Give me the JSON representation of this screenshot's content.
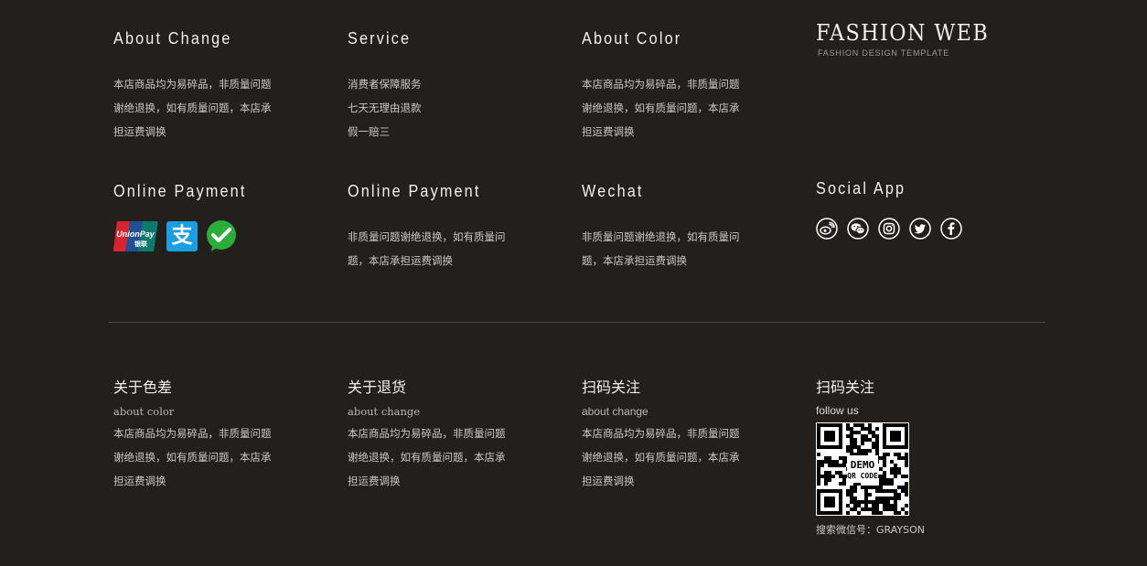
{
  "top_row": [
    {
      "heading": "About Change",
      "lines": [
        "本店商品均为易碎品，非质量问题",
        "谢绝退换，如有质量问题，本店承",
        "担运费调换"
      ]
    },
    {
      "heading": "Service",
      "lines": [
        "消费者保障服务",
        "七天无理由退款",
        "假一赔三"
      ]
    },
    {
      "heading": "About Color",
      "lines": [
        "本店商品均为易碎品，非质量问题",
        "谢绝退换，如有质量问题，本店承",
        "担运费调换"
      ]
    }
  ],
  "brand": {
    "title": "FASHION WEB",
    "subtitle": "FASHION DESIGN TEMPLATE"
  },
  "middle_row": [
    {
      "heading": "Online Payment",
      "payment_icons": [
        "unionpay-icon",
        "alipay-icon",
        "wechat-pay-icon"
      ],
      "alipay_glyph": "支"
    },
    {
      "heading": "Online Payment",
      "lines": [
        "非质量问题谢绝退换，如有质量问",
        "题，本店承担运费调换"
      ]
    },
    {
      "heading": "Wechat",
      "lines": [
        "非质量问题谢绝退换，如有质量问",
        "题，本店承担运费调换"
      ]
    },
    {
      "heading": "Social App",
      "social_icons": [
        "weibo-icon",
        "wechat-icon",
        "instagram-icon",
        "twitter-icon",
        "facebook-icon"
      ]
    }
  ],
  "bottom_row": [
    {
      "heading": "关于色差",
      "sub": "about color",
      "lines": [
        "本店商品均为易碎品，非质量问题",
        "谢绝退换，如有质量问题，本店承",
        "担运费调换"
      ]
    },
    {
      "heading": "关于退货",
      "sub": "about change",
      "lines": [
        "本店商品均为易碎品，非质量问题",
        "谢绝退换，如有质量问题，本店承",
        "担运费调换"
      ]
    },
    {
      "heading": "扫码关注",
      "sub": "about change",
      "lines": [
        "本店商品均为易碎品，非质量问题",
        "谢绝退换，如有质量问题，本店承",
        "担运费调换"
      ]
    },
    {
      "heading": "扫码关注",
      "sub": "follow us",
      "qr_label_1": "DEMO",
      "qr_label_2": "QR CODE",
      "caption": "搜索微信号：GRAYSON"
    }
  ],
  "colors": {
    "background": "#221f1d",
    "unionpay_red": "#d8242f",
    "unionpay_blue": "#1f4f94",
    "unionpay_green": "#0e7a6c",
    "alipay": "#1a9fe3",
    "wechat": "#2aae3a"
  }
}
